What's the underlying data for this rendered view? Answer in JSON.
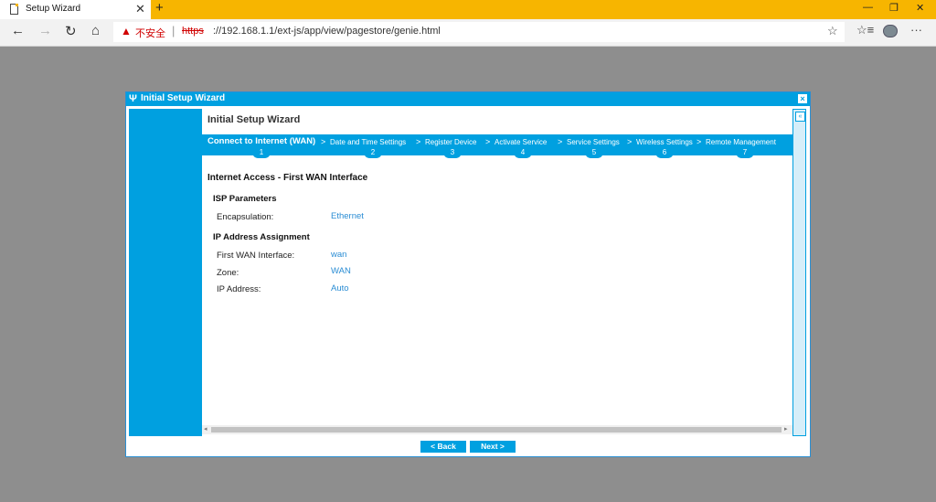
{
  "browser": {
    "tab_title": "Setup Wizard",
    "tab_close": "✕",
    "new_tab": "+",
    "window_controls": {
      "minimize": "—",
      "restore": "❐",
      "close": "✕"
    },
    "nav": {
      "back": "←",
      "forward": "→",
      "reload": "↻",
      "home": "⌂"
    },
    "security_warning": "不安全",
    "url_separator": "|",
    "url_scheme": "https",
    "url_rest": "://192.168.1.1/ext-js/app/view/pagestore/genie.html",
    "favorite_star": "☆",
    "favorites_bar": "☆≡",
    "menu": "···"
  },
  "dialog": {
    "title": "Initial Setup Wizard",
    "close_glyph": "×",
    "wizard_title": "Initial Setup Wizard",
    "steps": [
      {
        "label": "Connect to Internet (WAN)",
        "number": "1"
      },
      {
        "label": "Date and Time Settings",
        "number": "2"
      },
      {
        "label": "Register Device",
        "number": "3"
      },
      {
        "label": "Activate Service",
        "number": "4"
      },
      {
        "label": "Service Settings",
        "number": "5"
      },
      {
        "label": "Wireless Settings",
        "number": "6"
      },
      {
        "label": "Remote Management",
        "number": "7"
      }
    ],
    "step_separator": ">",
    "heading": "Internet Access - First WAN Interface",
    "isp_section": {
      "title": "ISP Parameters",
      "encapsulation_label": "Encapsulation:",
      "encapsulation_value": "Ethernet"
    },
    "ip_section": {
      "title": "IP Address Assignment",
      "first_wan_label": "First WAN Interface:",
      "first_wan_value": "wan",
      "zone_label": "Zone:",
      "zone_value": "WAN",
      "ip_label": "IP Address:",
      "ip_value": "Auto"
    },
    "collapse_glyph": "«",
    "scroll_left": "◂",
    "scroll_right": "▸",
    "back_button": "< Back",
    "next_button": "Next >"
  }
}
